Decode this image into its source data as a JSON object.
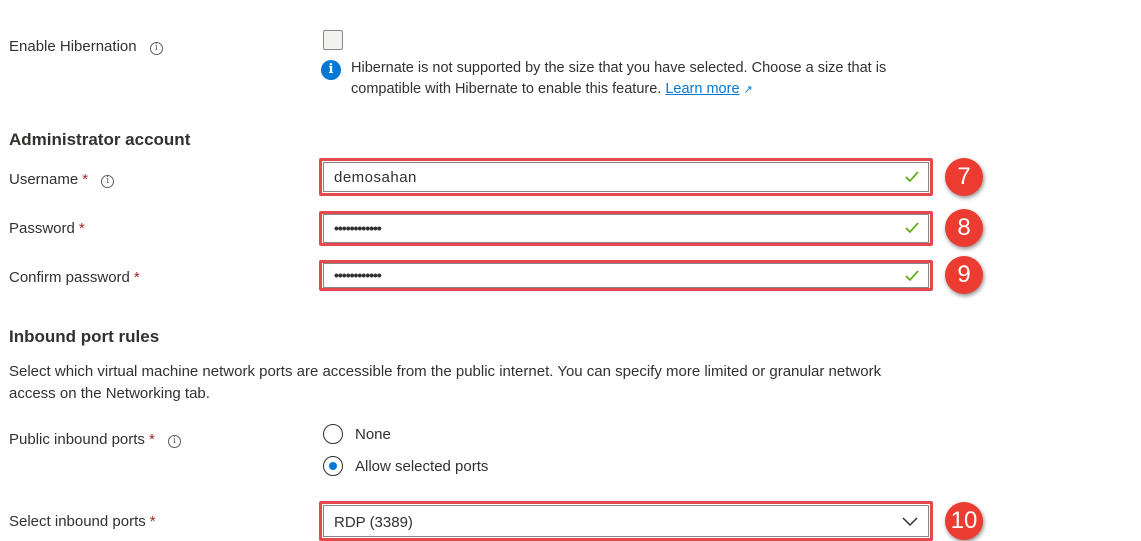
{
  "hibernation": {
    "label": "Enable Hibernation",
    "checked": false,
    "notice_text": "Hibernate is not supported by the size that you have selected. Choose a size that is compatible with Hibernate to enable this feature.",
    "learn_more": "Learn more"
  },
  "admin": {
    "section_title": "Administrator account",
    "username": {
      "label": "Username",
      "required": "*",
      "value": "demosahan",
      "step": "7"
    },
    "password": {
      "label": "Password",
      "required": "*",
      "value": "••••••••••••",
      "step": "8"
    },
    "confirm_password": {
      "label": "Confirm password",
      "required": "*",
      "value": "••••••••••••",
      "step": "9"
    }
  },
  "inbound": {
    "section_title": "Inbound port rules",
    "description": "Select which virtual machine network ports are accessible from the public internet. You can specify more limited or granular network access on the Networking tab.",
    "public_ports": {
      "label": "Public inbound ports",
      "required": "*",
      "options": [
        {
          "label": "None",
          "selected": false
        },
        {
          "label": "Allow selected ports",
          "selected": true
        }
      ]
    },
    "select_ports": {
      "label": "Select inbound ports",
      "required": "*",
      "value": "RDP (3389)",
      "step": "10"
    }
  },
  "colors": {
    "accent": "#0078d4",
    "valid_check": "#57a300",
    "highlight": "#e5484d",
    "badge": "#ec3b30"
  },
  "icons": [
    "info-icon",
    "checkmark-icon",
    "external-link-icon",
    "chevron-down-icon"
  ]
}
